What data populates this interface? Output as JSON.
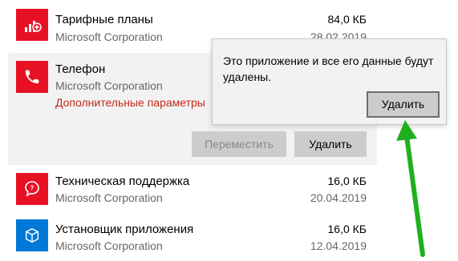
{
  "apps": [
    {
      "name": "Тарифные планы",
      "publisher": "Microsoft Corporation",
      "size": "84,0 КБ",
      "date": "28.02.2019",
      "icon": "tariff-icon"
    },
    {
      "name": "Телефон",
      "publisher": "Microsoft Corporation",
      "advanced": "Дополнительные параметры",
      "icon": "phone-icon"
    },
    {
      "name": "Техническая поддержка",
      "publisher": "Microsoft Corporation",
      "size": "16,0 КБ",
      "date": "20.04.2019",
      "icon": "support-icon"
    },
    {
      "name": "Установщик приложения",
      "publisher": "Microsoft Corporation",
      "size": "16,0 КБ",
      "date": "12.04.2019",
      "icon": "installer-icon"
    }
  ],
  "actions": {
    "move_label": "Переместить",
    "uninstall_label": "Удалить"
  },
  "flyout": {
    "message": "Это приложение и все его данные будут удалены.",
    "confirm_label": "Удалить"
  },
  "colors": {
    "tile_red": "#e81123",
    "tile_blue": "#0078d7",
    "advanced_link": "#c42b1c",
    "arrow_green": "#1fb01f"
  }
}
